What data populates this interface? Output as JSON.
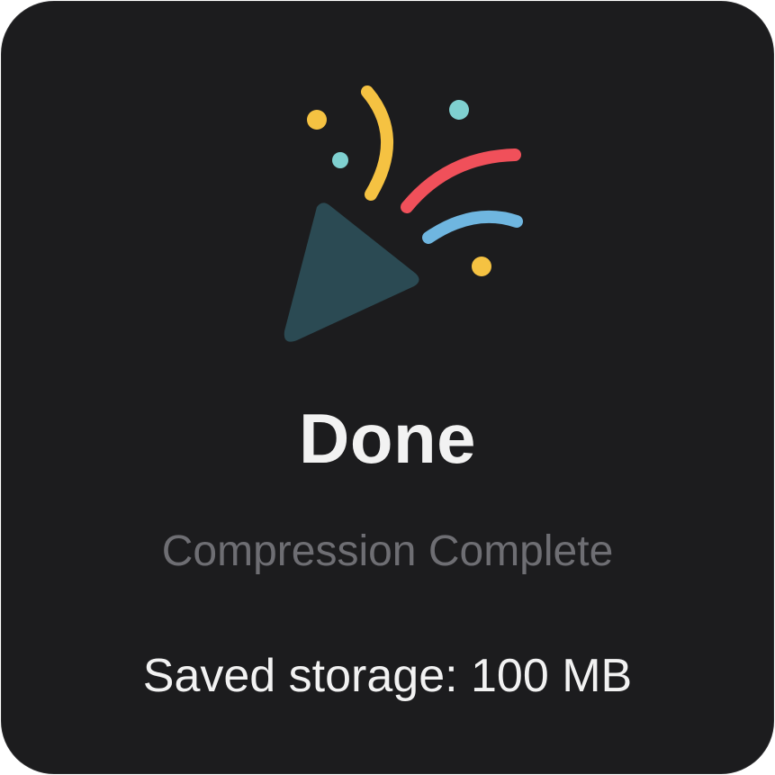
{
  "dialog": {
    "icon": "party-popper-icon",
    "title": "Done",
    "subtitle": "Compression Complete",
    "saved_text": "Saved storage: 100 MB"
  },
  "colors": {
    "background": "#1c1c1e",
    "title": "#f2f2f2",
    "subtitle": "#6e6e73",
    "popper": "#2b4a53",
    "confetti_yellow": "#f5c242",
    "confetti_red": "#f0505a",
    "confetti_blue": "#6fb6e0",
    "confetti_teal": "#7fd0d0"
  }
}
